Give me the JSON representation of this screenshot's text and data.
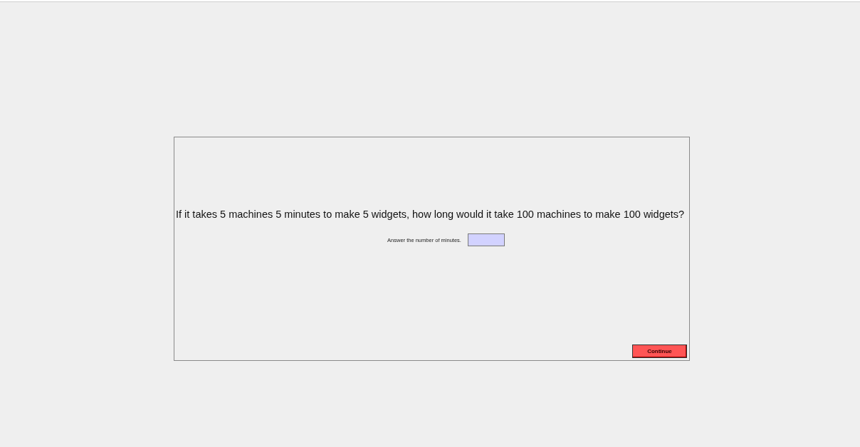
{
  "question": "If it takes 5 machines 5 minutes to make 5 widgets, how long would it take 100 machines to make 100 widgets?",
  "answer": {
    "label": "Answer the number of minutes."
  },
  "buttons": [
    {
      "label": "Continue",
      "kind": "primary"
    }
  ]
}
